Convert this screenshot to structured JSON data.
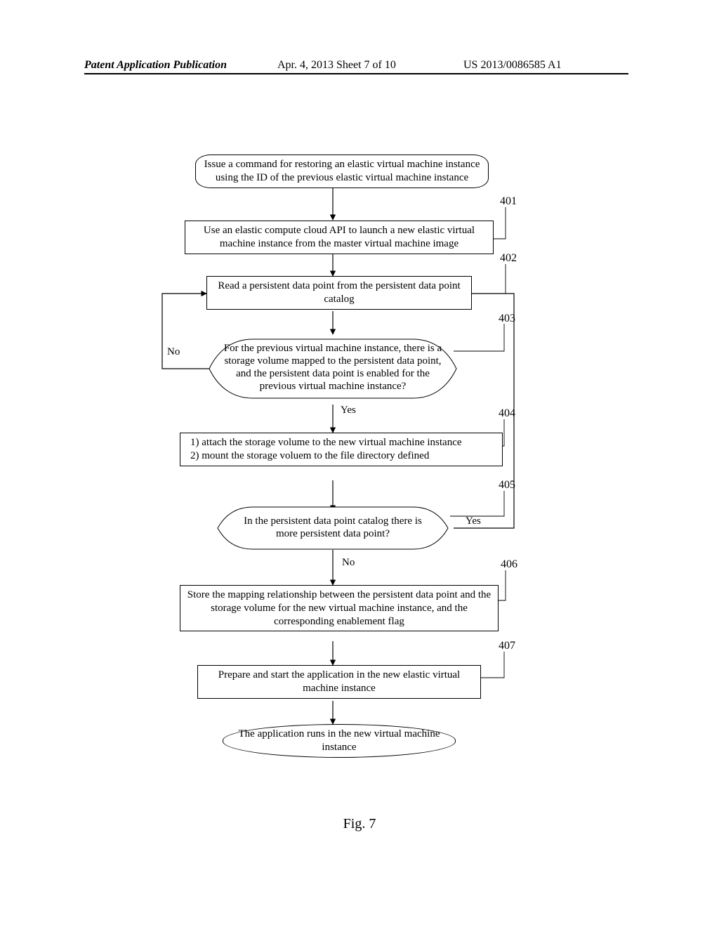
{
  "header": {
    "left": "Patent Application Publication",
    "center": "Apr. 4, 2013  Sheet 7 of 10",
    "right": "US 2013/0086585 A1"
  },
  "figure_caption": "Fig. 7",
  "nodes": {
    "start": "Issue a command for restoring an elastic virtual machine instance using the ID of the previous elastic virtual machine instance",
    "n401": "Use an elastic compute cloud API to launch a new elastic virtual machine instance from the master virtual machine image",
    "n402": "Read a persistent data point from the persistent data point catalog",
    "n403": "For the previous virtual machine instance, there is a storage volume mapped to the persistent data point, and the persistent data point is enabled for the previous virtual machine instance?",
    "n404": "1)  attach the storage volume to the new virtual machine instance\n2)  mount the storage voluem to the file directory defined",
    "n405": "In the persistent data point catalog there is more persistent data point?",
    "n406": "Store the mapping relationship between the persistent data point and the storage volume for the new virtual machine instance, and the corresponding enablement flag",
    "n407": "Prepare and start the application in the new elastic virtual machine instance",
    "end": "The application runs in the new virtual machine instance"
  },
  "refs": {
    "r401": "401",
    "r402": "402",
    "r403": "403",
    "r404": "404",
    "r405": "405",
    "r406": "406",
    "r407": "407"
  },
  "labels": {
    "no": "No",
    "yes": "Yes"
  }
}
